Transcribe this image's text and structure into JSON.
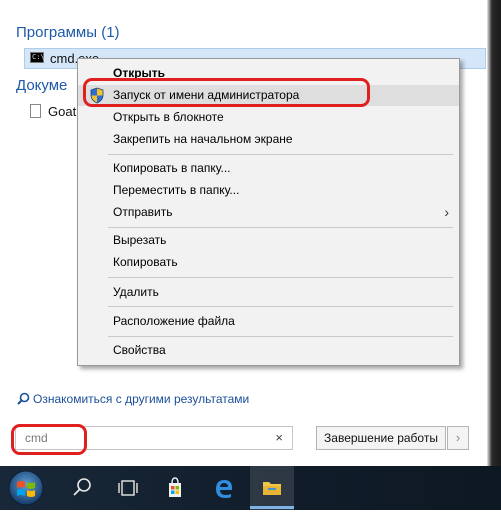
{
  "search_results": {
    "programs_header": "Программы (1)",
    "program_item": "cmd.exe",
    "documents_header": "Докуме",
    "document_item": "Goat"
  },
  "context_menu": {
    "items": [
      {
        "label": "Открыть",
        "bold": true
      },
      {
        "label": "Запуск от имени администратора",
        "hovered": true,
        "icon": "uac-shield-icon"
      },
      {
        "label": "Открыть в блокноте"
      },
      {
        "label": "Закрепить на начальном экране"
      },
      {
        "label": "Копировать в папку..."
      },
      {
        "label": "Переместить в папку..."
      },
      {
        "label": "Отправить",
        "submenu": true
      },
      {
        "label": "Вырезать"
      },
      {
        "label": "Копировать"
      },
      {
        "label": "Удалить"
      },
      {
        "label": "Расположение файла"
      },
      {
        "label": "Свойства"
      }
    ],
    "submenu_arrow": "›"
  },
  "start_menu": {
    "more_results_link": "Ознакомиться с другими результатами",
    "search_value": "cmd",
    "clear_glyph": "×",
    "shutdown_label": "Завершение работы",
    "shutdown_arrow": "›"
  },
  "taskbar": {
    "icons": [
      "windows-start-orb-icon",
      "search-icon",
      "task-view-icon",
      "store-icon",
      "edge-icon",
      "file-explorer-icon"
    ],
    "active": "file-explorer-icon"
  },
  "colors": {
    "header_blue": "#1e5aa8",
    "highlight_red": "#e0201f",
    "selection_blue": "#d4e6f7",
    "taskbar": "#122232"
  }
}
